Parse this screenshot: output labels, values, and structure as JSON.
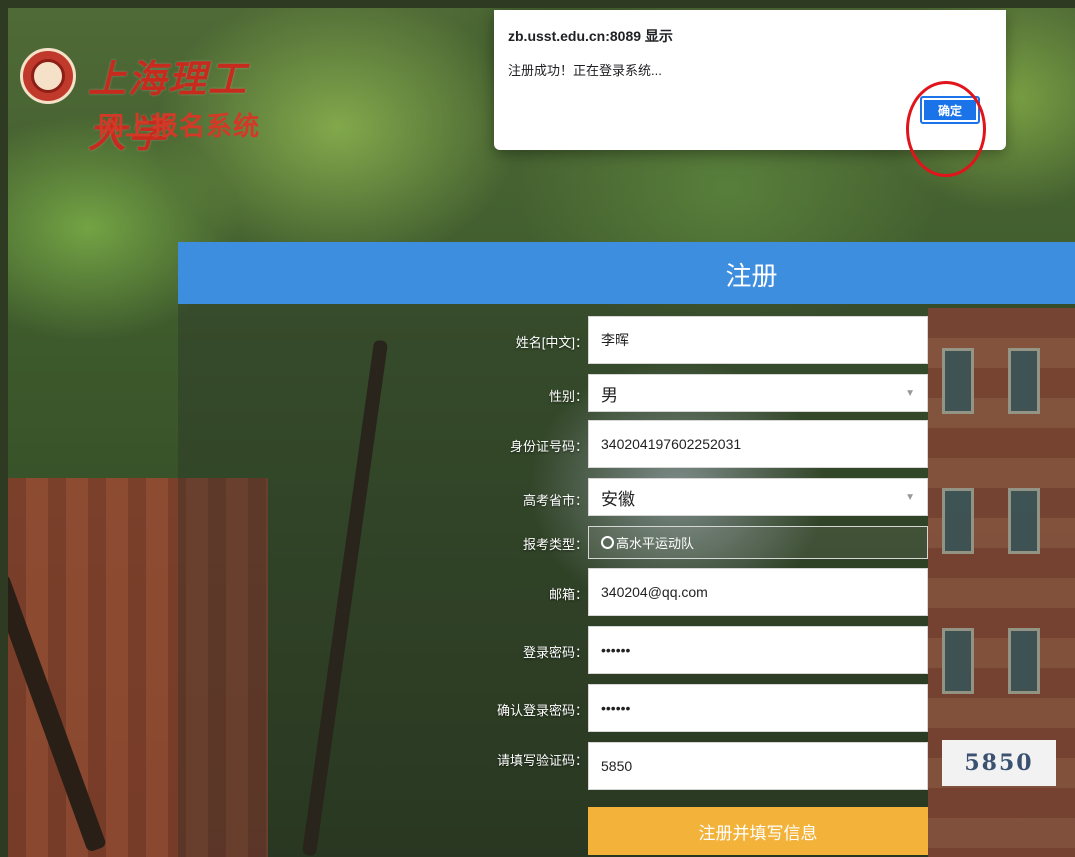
{
  "dialog": {
    "origin": "zb.usst.edu.cn:8089 显示",
    "message": "注册成功！正在登录系统...",
    "ok_label": "确定"
  },
  "logo": {
    "title": "上海理工大学",
    "subtitle": "网上报名系统"
  },
  "form": {
    "title": "注册",
    "fields": [
      {
        "label": "姓名[中文]：",
        "value": "李晖"
      },
      {
        "label": "性别：",
        "value": "男"
      },
      {
        "label": "身份证号码：",
        "value": "340204197602252031"
      },
      {
        "label": "高考省市：",
        "value": "安徽"
      },
      {
        "label": "报考类型：",
        "value": "高水平运动队"
      },
      {
        "label": "邮箱：",
        "value": "340204@qq.com"
      },
      {
        "label": "登录密码：",
        "value": "••••••"
      },
      {
        "label": "确认登录密码：",
        "value": "••••••"
      },
      {
        "label": "请填写验证码：",
        "value": "5850"
      }
    ],
    "captcha_text": "5850",
    "submit_label": "注册并填写信息"
  },
  "colors": {
    "header": "#3e8ee0",
    "submit": "#f3b33a",
    "dialog_button": "#1a73e8",
    "highlight": "#e0141a"
  }
}
